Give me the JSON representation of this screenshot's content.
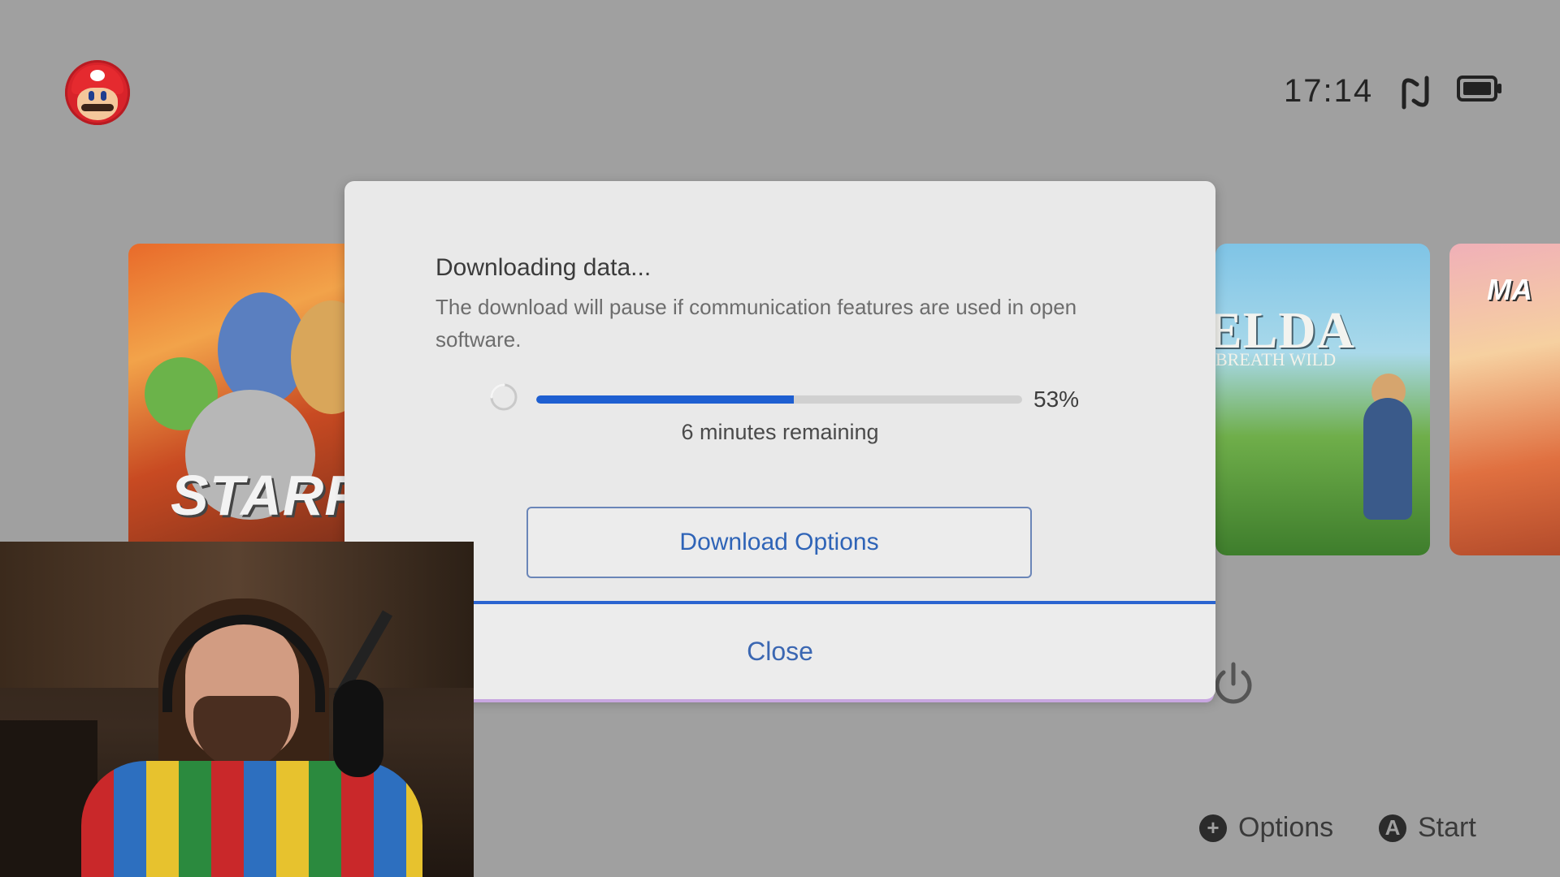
{
  "header": {
    "clock": "17:14",
    "avatar_icon": "mario-avatar-icon",
    "wifi_icon": "wifi-signal-icon",
    "battery_icon": "battery-icon"
  },
  "tiles": [
    {
      "name": "starfox",
      "logo": "STARF"
    },
    {
      "name": "zelda",
      "logo": "ELDA",
      "subtitle": "BREATH WILD"
    },
    {
      "name": "mario",
      "logo": "MA"
    }
  ],
  "dialog": {
    "title": "Downloading data...",
    "description": "The download will pause if communication features are used in open software.",
    "progress_percent": 53,
    "progress_label": "53%",
    "remaining": "6 minutes remaining",
    "options_button": "Download Options",
    "close_button": "Close"
  },
  "footer": {
    "options_label": "Options",
    "start_label": "Start",
    "options_glyph": "+",
    "start_glyph": "A"
  },
  "colors": {
    "accent": "#1e5fd1",
    "background": "#a0a0a0",
    "dialog_bg": "#e9e9e9"
  }
}
